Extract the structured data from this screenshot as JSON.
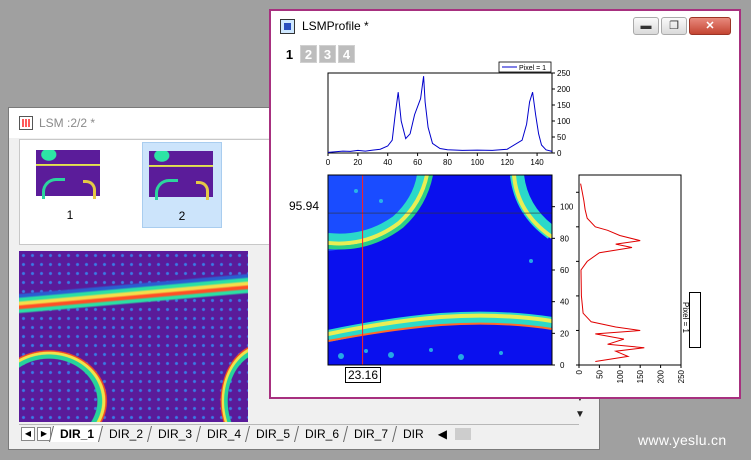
{
  "back_window": {
    "title": "LSM :2/2  *",
    "thumbnails": [
      {
        "label": "1",
        "selected": false
      },
      {
        "label": "2",
        "selected": true
      }
    ],
    "sheet_tabs": [
      "DIR_1",
      "DIR_2",
      "DIR_3",
      "DIR_4",
      "DIR_5",
      "DIR_6",
      "DIR_7",
      "DIR"
    ],
    "active_tab": "DIR_1"
  },
  "front_window": {
    "title": "LSMProfile *",
    "layer_tabs": [
      "1",
      "2",
      "3",
      "4"
    ],
    "active_layer": "1",
    "y_value_label": "95.94",
    "x_value_label": "23.16",
    "accent_color": "#a7307f"
  },
  "chart_data": [
    {
      "type": "line",
      "name": "top-profile",
      "legend": "Pixel = 1",
      "color": "#0000cc",
      "xlim": [
        0,
        150
      ],
      "ylim": [
        0,
        250
      ],
      "x_ticks": [
        0,
        20,
        40,
        60,
        80,
        100,
        120,
        140
      ],
      "y_ticks": [
        0,
        50,
        100,
        150,
        200,
        250
      ],
      "x": [
        0,
        5,
        10,
        15,
        20,
        25,
        30,
        35,
        40,
        43,
        45,
        47,
        49,
        52,
        55,
        58,
        62,
        64,
        65,
        67,
        70,
        75,
        80,
        90,
        100,
        110,
        120,
        130,
        133,
        135,
        137,
        139,
        141,
        143,
        146,
        150
      ],
      "y": [
        2,
        4,
        6,
        5,
        8,
        6,
        9,
        12,
        22,
        40,
        120,
        190,
        100,
        45,
        60,
        120,
        170,
        240,
        160,
        80,
        30,
        14,
        10,
        8,
        9,
        8,
        12,
        40,
        90,
        160,
        190,
        120,
        60,
        25,
        10,
        5
      ]
    },
    {
      "type": "line",
      "name": "side-profile",
      "legend": "Pixel = 1",
      "color": "#e00000",
      "xlim": [
        0,
        250
      ],
      "ylim": [
        0,
        110
      ],
      "x_ticks": [
        0,
        50,
        100,
        150,
        200,
        250
      ],
      "y_ticks": [
        0,
        20,
        40,
        60,
        80,
        100
      ],
      "y": [
        2,
        5,
        8,
        10,
        12,
        15,
        18,
        20,
        22,
        25,
        30,
        40,
        55,
        60,
        65,
        68,
        70,
        72,
        75,
        78,
        80,
        85,
        90,
        95,
        100,
        105
      ],
      "x": [
        40,
        120,
        90,
        160,
        70,
        110,
        40,
        150,
        90,
        30,
        10,
        6,
        5,
        20,
        50,
        130,
        90,
        150,
        100,
        70,
        40,
        20,
        15,
        12,
        8,
        4
      ]
    },
    {
      "type": "heatmap",
      "name": "lsm-image",
      "xlim": [
        0,
        150
      ],
      "ylim": [
        0,
        120
      ],
      "x_ticks": [
        0,
        20,
        40,
        60,
        80,
        100,
        120,
        140
      ],
      "y_ticks": [
        0,
        20,
        40,
        60,
        80,
        100
      ],
      "crosshair_x": 23.16,
      "crosshair_y": 95.94
    }
  ],
  "watermark": "www.yeslu.cn"
}
